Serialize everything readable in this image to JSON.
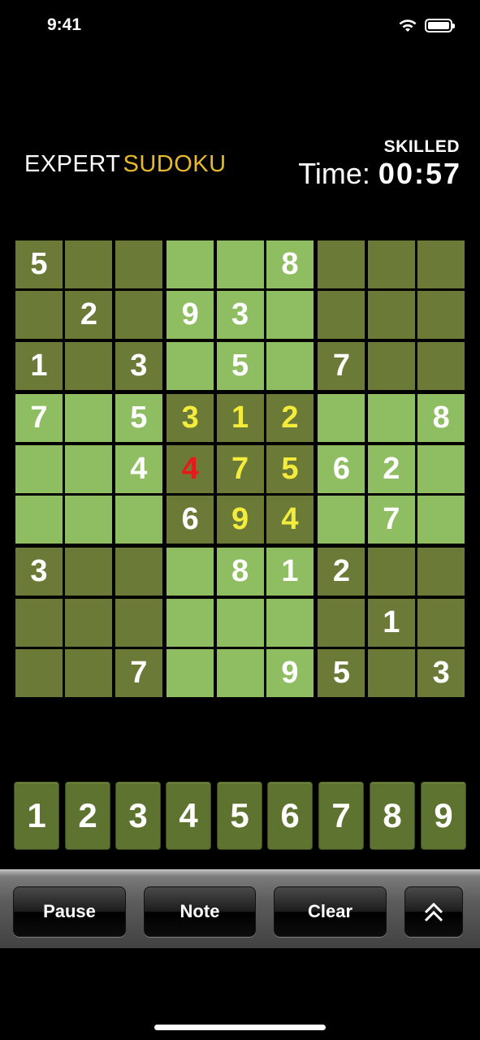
{
  "status": {
    "time": "9:41"
  },
  "header": {
    "logo_word1": "EXPERT",
    "logo_word2": "SUDOKU",
    "level": "SKILLED",
    "time_label": "Time:",
    "time_value": "00:57"
  },
  "board": {
    "rows": [
      [
        "5",
        "",
        "",
        "",
        "",
        "8",
        "",
        "",
        ""
      ],
      [
        "",
        "2",
        "",
        "9",
        "3",
        "",
        "",
        "",
        ""
      ],
      [
        "1",
        "",
        "3",
        "",
        "5",
        "",
        "7",
        "",
        ""
      ],
      [
        "7",
        "",
        "5",
        "3",
        "1",
        "2",
        "",
        "",
        "8"
      ],
      [
        "",
        "",
        "4",
        "4",
        "7",
        "5",
        "6",
        "2",
        ""
      ],
      [
        "",
        "",
        "",
        "6",
        "9",
        "4",
        "",
        "7",
        ""
      ],
      [
        "3",
        "",
        "",
        "",
        "8",
        "1",
        "2",
        "",
        ""
      ],
      [
        "",
        "",
        "",
        "",
        "",
        "",
        "",
        "1",
        ""
      ],
      [
        "",
        "",
        "7",
        "",
        "",
        "9",
        "5",
        "",
        "3"
      ]
    ],
    "yellow_cells": [
      "3-3",
      "3-4",
      "3-5",
      "4-4",
      "4-5",
      "5-4",
      "5-5"
    ],
    "red_cells": [
      "4-3"
    ],
    "colors": {
      "dark": "#6b7a36",
      "light": "#8fbe62",
      "yellow": "#f4ec3c",
      "red": "#e31b1b"
    }
  },
  "keypad": [
    "1",
    "2",
    "3",
    "4",
    "5",
    "6",
    "7",
    "8",
    "9"
  ],
  "toolbar": {
    "pause": "Pause",
    "note": "Note",
    "clear": "Clear",
    "more_icon": "double-chevron-up-icon"
  }
}
